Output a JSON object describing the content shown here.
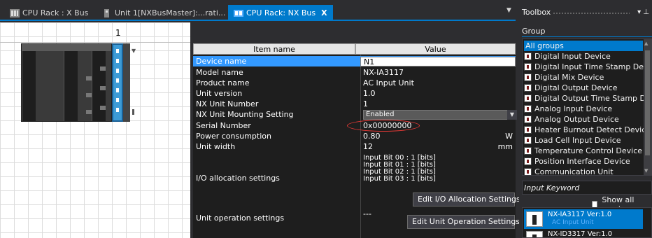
{
  "tabs": [
    {
      "label": "CPU Rack : X Bus"
    },
    {
      "label": "Unit 1[NXBusMaster]:...rati..."
    },
    {
      "label": "CPU Rack: NX Bus",
      "close": "X"
    }
  ],
  "rack": {
    "slot_number": "1"
  },
  "properties": {
    "header": {
      "name_col": "Item name",
      "value_col": "Value"
    },
    "rows": [
      {
        "name": "Device name",
        "value": "N1"
      },
      {
        "name": "Model name",
        "value": "NX-IA3117"
      },
      {
        "name": "Product name",
        "value": "AC Input Unit"
      },
      {
        "name": "Unit version",
        "value": "1.0"
      },
      {
        "name": "NX Unit Number",
        "value": "1"
      },
      {
        "name": "NX Unit Mounting Setting",
        "value": "Enabled"
      },
      {
        "name": "Serial Number",
        "value": "0x00000000"
      },
      {
        "name": "Power consumption",
        "value": "0.80",
        "unit": "W"
      },
      {
        "name": "Unit width",
        "value": "12",
        "unit": "mm"
      }
    ],
    "io_allocation": {
      "name": "I/O allocation settings",
      "bits": [
        "Input Bit 00 : 1 [bits]",
        "Input Bit 01 : 1 [bits]",
        "Input Bit 02 : 1 [bits]",
        "Input Bit 03 : 1 [bits]"
      ],
      "button": "Edit I/O Allocation Settings"
    },
    "unit_operation": {
      "name": "Unit operation settings",
      "value": "---",
      "button": "Edit Unit Operation Settings"
    }
  },
  "toolbox": {
    "title": "Toolbox",
    "controls": "▾ ⊥",
    "group_label": "Group",
    "groups": [
      "All groups",
      "Digital Input Device",
      "Digital Input Time Stamp De",
      "Digital Mix Device",
      "Digital Output Device",
      "Digital Output Time Stamp D",
      "Analog Input Device",
      "Analog Output Device",
      "Heater Burnout Detect Devic",
      "Load Cell Input Device",
      "Temperature Control Device",
      "Position Interface Device",
      "Communication Unit"
    ],
    "keyword_label": "Input Keyword",
    "show_all_label": "Show all version",
    "devices": [
      {
        "name": "NX-IA3117 Ver:1.0",
        "sub": "AC Input Unit"
      },
      {
        "name": "NX-ID3317 Ver:1.0",
        "sub": ""
      }
    ]
  },
  "colors": {
    "accent": "#007acc",
    "selection": "#3399ff",
    "highlight_oval": "#e53935"
  }
}
